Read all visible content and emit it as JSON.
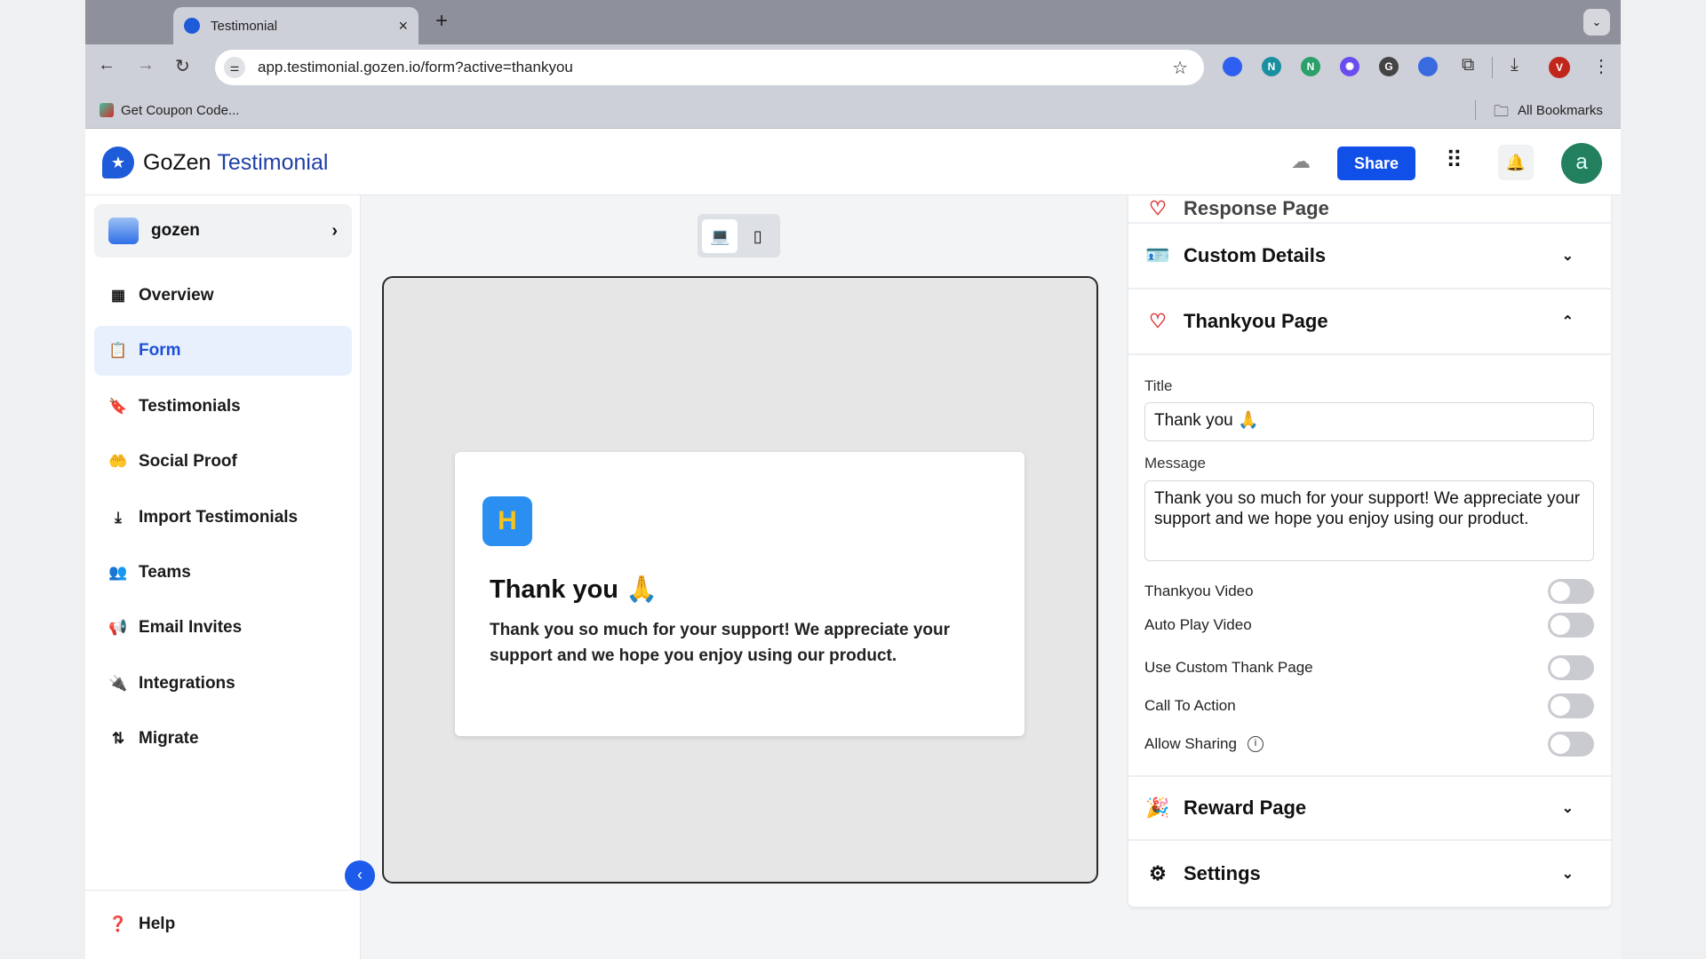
{
  "browser": {
    "tab_title": "Testimonial",
    "url": "app.testimonial.gozen.io/form?active=thankyou",
    "bookmark": "Get Coupon Code...",
    "all_bookmarks": "All Bookmarks",
    "profile_initial": "V",
    "extensions": [
      {
        "letter": "",
        "color": "#2f5ff0"
      },
      {
        "letter": "N",
        "color": "#1a8fa0"
      },
      {
        "letter": "N",
        "color": "#2aa06a"
      },
      {
        "letter": "✺",
        "color": "#6a4cf0"
      },
      {
        "letter": "G",
        "color": "#444444"
      },
      {
        "letter": "",
        "color": "#3a6ae0"
      }
    ]
  },
  "header": {
    "brand_a": "GoZen",
    "brand_b": "Testimonial",
    "share_label": "Share",
    "avatar_initial": "a",
    "accent": "#1150e8"
  },
  "sidebar": {
    "workspace": "gozen",
    "items": [
      {
        "label": "Overview",
        "icon": "grid-icon"
      },
      {
        "label": "Form",
        "icon": "clipboard-icon",
        "active": true
      },
      {
        "label": "Testimonials",
        "icon": "bookmark-icon"
      },
      {
        "label": "Social Proof",
        "icon": "hand-heart-icon"
      },
      {
        "label": "Import Testimonials",
        "icon": "download-icon"
      },
      {
        "label": "Teams",
        "icon": "users-icon"
      },
      {
        "label": "Email Invites",
        "icon": "megaphone-icon"
      },
      {
        "label": "Integrations",
        "icon": "plug-icon"
      },
      {
        "label": "Migrate",
        "icon": "arrows-icon"
      }
    ],
    "help": "Help"
  },
  "preview": {
    "logo_letter": "H",
    "title": "Thank you 🙏",
    "message": "Thank you so much for your support! We appreciate your support and we hope you enjoy using our product."
  },
  "panel": {
    "sections": {
      "response": "Response Page",
      "custom": "Custom Details",
      "thankyou": "Thankyou Page",
      "reward": "Reward Page",
      "settings": "Settings"
    },
    "title_label": "Title",
    "title_value": "Thank you 🙏",
    "message_label": "Message",
    "message_value": "Thank you so much for your support! We appreciate your support and we hope you enjoy using our product.",
    "toggles": [
      {
        "label": "Thankyou Video",
        "on": false
      },
      {
        "label": "Auto Play Video",
        "on": false
      },
      {
        "label": "Use Custom Thank Page",
        "on": false
      },
      {
        "label": "Call To Action",
        "on": false
      },
      {
        "label": "Allow Sharing",
        "on": false,
        "info": true
      }
    ]
  }
}
